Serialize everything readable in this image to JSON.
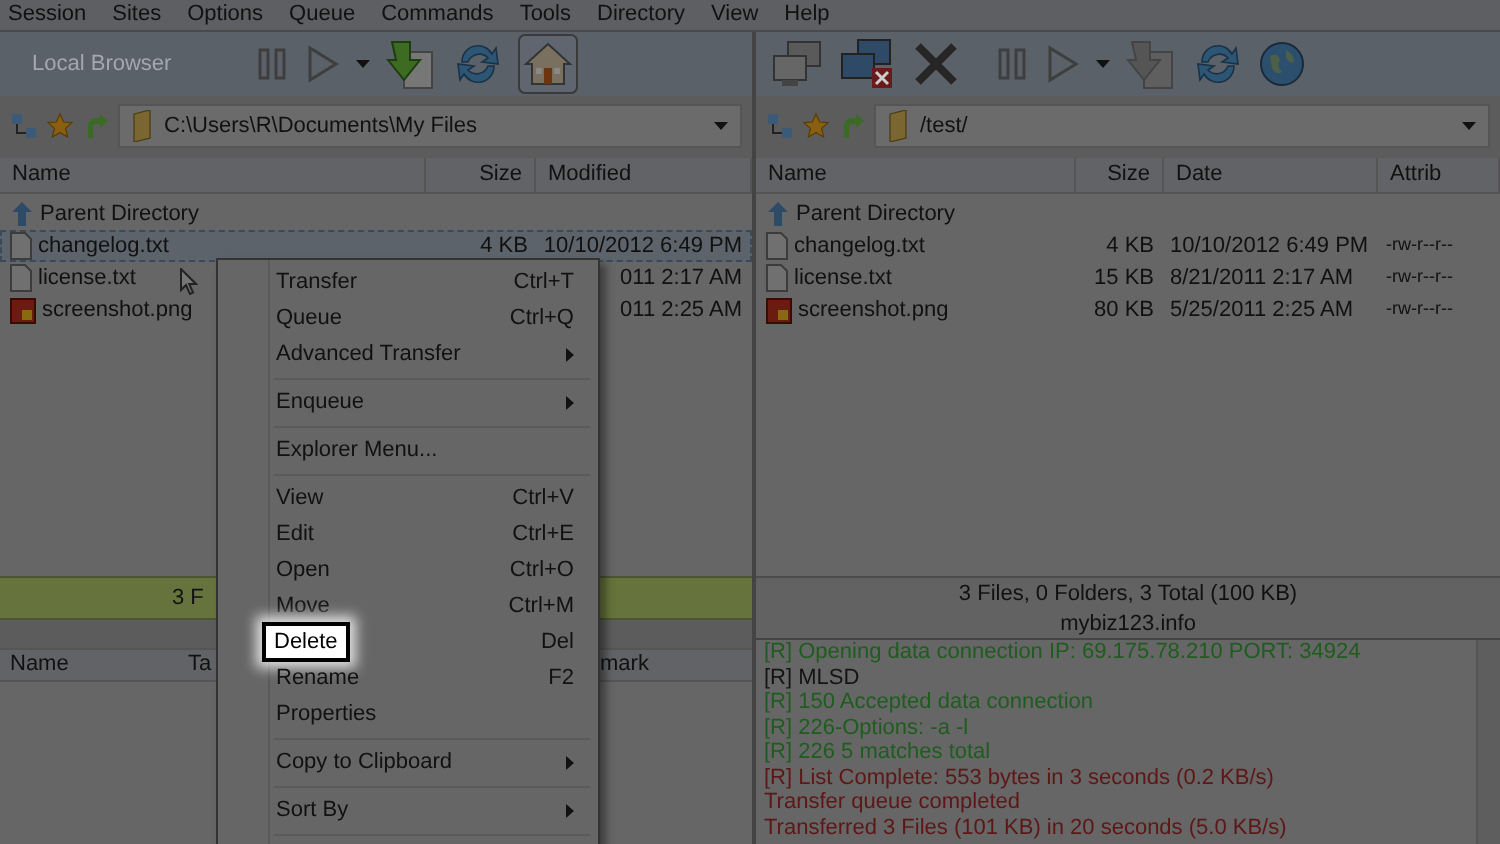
{
  "menu_bar": [
    "Session",
    "Sites",
    "Options",
    "Queue",
    "Commands",
    "Tools",
    "Directory",
    "View",
    "Help"
  ],
  "left_pane": {
    "toolbar_label": "Local Browser",
    "path": "C:\\Users\\R\\Documents\\My Files",
    "columns": [
      "Name",
      "Size",
      "Modified"
    ],
    "rows": [
      {
        "kind": "parent",
        "name": "Parent Directory",
        "selected": false
      },
      {
        "kind": "text",
        "name": "changelog.txt",
        "size": "4 KB",
        "modified": "10/10/2012 6:49 PM",
        "selected": true
      },
      {
        "kind": "text",
        "name": "license.txt",
        "modified": "011 2:17 AM",
        "selected": false
      },
      {
        "kind": "image",
        "name": "screenshot.png",
        "modified": "011 2:25 AM",
        "selected": false
      }
    ],
    "status": "3 F",
    "queue_columns": [
      "Name",
      "Ta",
      "mark"
    ]
  },
  "right_pane": {
    "path": "/test/",
    "columns": [
      "Name",
      "Size",
      "Date",
      "Attrib"
    ],
    "rows": [
      {
        "kind": "parent",
        "name": "Parent Directory"
      },
      {
        "kind": "text",
        "name": "changelog.txt",
        "size": "4 KB",
        "date": "10/10/2012 6:49 PM",
        "attrib": "-rw-r--r--"
      },
      {
        "kind": "text",
        "name": "license.txt",
        "size": "15 KB",
        "date": "8/21/2011 2:17 AM",
        "attrib": "-rw-r--r--"
      },
      {
        "kind": "image",
        "name": "screenshot.png",
        "size": "80 KB",
        "date": "5/25/2011 2:25 AM",
        "attrib": "-rw-r--r--"
      }
    ],
    "status": "3 Files, 0 Folders, 3 Total (100 KB)",
    "host": "mybiz123.info",
    "log": [
      {
        "text": "[R] Opening data connection IP: 69.175.78.210 PORT: 34924",
        "color": "#1f5c1f"
      },
      {
        "text": "[R] MLSD",
        "color": "#141414"
      },
      {
        "text": "[R] 150 Accepted data connection",
        "color": "#1f5c1f"
      },
      {
        "text": "[R] 226-Options: -a -l",
        "color": "#1f5c1f"
      },
      {
        "text": "[R] 226 5 matches total",
        "color": "#1f5c1f"
      },
      {
        "text": "[R] List Complete: 553 bytes in 3 seconds (0.2 KB/s)",
        "color": "#5e1616"
      },
      {
        "text": "Transfer queue completed",
        "color": "#5e1616"
      },
      {
        "text": "Transferred 3 Files (101 KB) in 20 seconds (5.0 KB/s)",
        "color": "#5e1616"
      }
    ]
  },
  "context_menu": [
    {
      "kind": "item",
      "label": "Transfer",
      "shortcut": "Ctrl+T",
      "selected": false
    },
    {
      "kind": "item",
      "label": "Queue",
      "shortcut": "Ctrl+Q",
      "selected": false
    },
    {
      "kind": "submenu",
      "label": "Advanced Transfer",
      "selected": false
    },
    {
      "kind": "separator"
    },
    {
      "kind": "submenu",
      "label": "Enqueue",
      "selected": false
    },
    {
      "kind": "separator"
    },
    {
      "kind": "item",
      "label": "Explorer Menu...",
      "selected": false
    },
    {
      "kind": "separator"
    },
    {
      "kind": "item",
      "label": "View",
      "shortcut": "Ctrl+V",
      "selected": false
    },
    {
      "kind": "item",
      "label": "Edit",
      "shortcut": "Ctrl+E",
      "selected": false
    },
    {
      "kind": "item",
      "label": "Open",
      "shortcut": "Ctrl+O",
      "selected": false
    },
    {
      "kind": "item",
      "label": "Move",
      "shortcut": "Ctrl+M",
      "selected": false
    },
    {
      "kind": "item",
      "label": "Delete",
      "shortcut": "Del",
      "selected": true
    },
    {
      "kind": "item",
      "label": "Rename",
      "shortcut": "F2",
      "selected": false
    },
    {
      "kind": "item",
      "label": "Properties",
      "selected": false
    },
    {
      "kind": "separator"
    },
    {
      "kind": "submenu",
      "label": "Copy to Clipboard",
      "selected": false
    },
    {
      "kind": "separator"
    },
    {
      "kind": "submenu",
      "label": "Sort By",
      "selected": false
    },
    {
      "kind": "separator"
    }
  ]
}
